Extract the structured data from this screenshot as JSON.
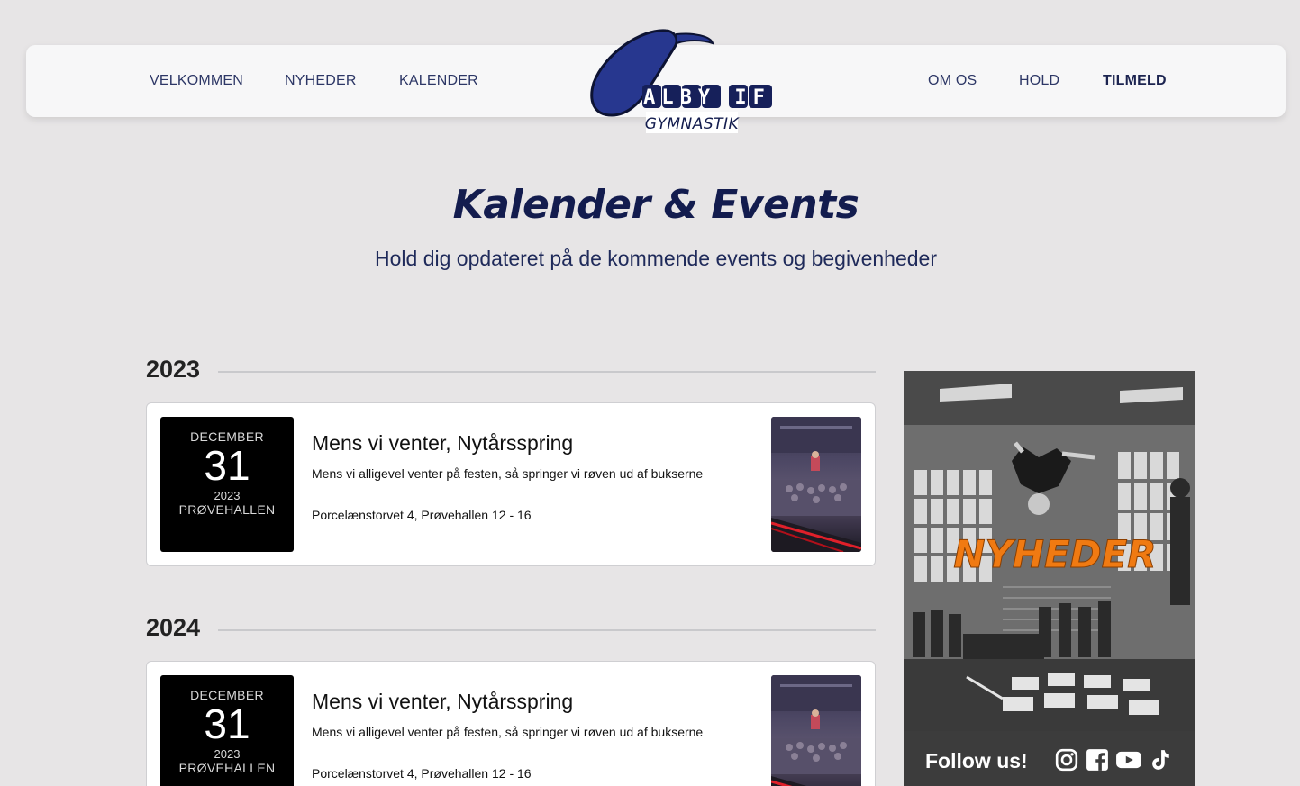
{
  "nav": {
    "left": [
      "VELKOMMEN",
      "NYHEDER",
      "KALENDER"
    ],
    "right": [
      "OM OS",
      "HOLD",
      "TILMELD"
    ]
  },
  "logo": {
    "name": "ALBY IF",
    "subtitle": "GYMNASTIK"
  },
  "hero": {
    "title": "Kalender & Events",
    "subtitle": "Hold dig opdateret på de kommende events og begivenheder"
  },
  "years": [
    {
      "year": "2023",
      "events": [
        {
          "month": "DECEMBER",
          "day": "31",
          "year": "2023",
          "venue": "PRØVEHALLEN",
          "title": "Mens vi venter, Nytårsspring",
          "description": "Mens vi alligevel venter på festen, så springer vi røven ud af bukserne",
          "location": "Porcelænstorvet 4, Prøvehallen 12 - 16"
        }
      ]
    },
    {
      "year": "2024",
      "events": [
        {
          "month": "DECEMBER",
          "day": "31",
          "year": "2023",
          "venue": "PRØVEHALLEN",
          "title": "Mens vi venter, Nytårsspring",
          "description": "Mens vi alligevel venter på festen, så springer vi røven ud af bukserne",
          "location": "Porcelænstorvet 4, Prøvehallen 12 - 16"
        }
      ]
    }
  ],
  "sidebar": {
    "promo_title": "NYHEDER",
    "follow_text": "Follow us!",
    "social_icons": [
      "instagram-icon",
      "facebook-icon",
      "youtube-icon",
      "tiktok-icon"
    ]
  },
  "colors": {
    "background": "#e7e5e6",
    "navy": "#1c2450",
    "logo_blue": "#27378f",
    "promo_orange": "#f07a12"
  }
}
